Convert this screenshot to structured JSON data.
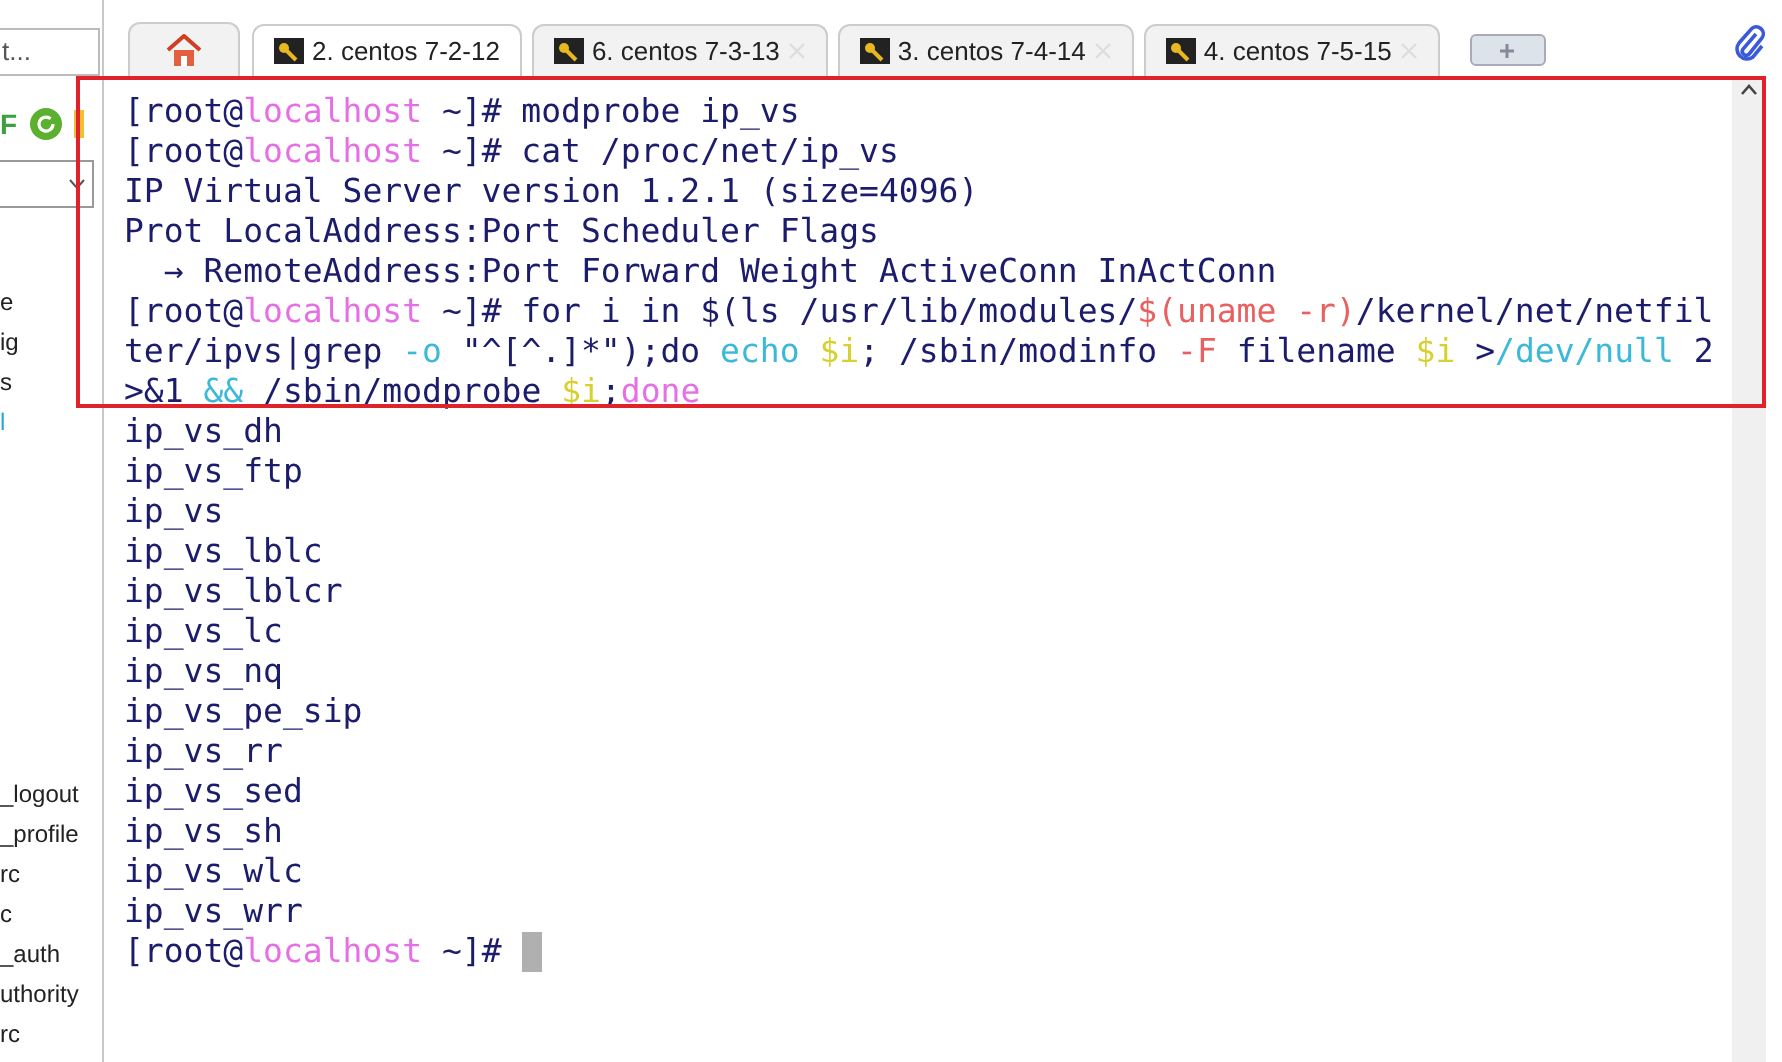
{
  "sidebar": {
    "search": {
      "value": "t..."
    },
    "letter": "F",
    "items_top": [
      {
        "label": "e",
        "selected": false
      },
      {
        "label": "ig",
        "selected": false
      },
      {
        "label": "s",
        "selected": false
      },
      {
        "label": "l",
        "selected": true
      }
    ],
    "items_bottom": [
      {
        "label": "_logout",
        "selected": false
      },
      {
        "label": "_profile",
        "selected": false
      },
      {
        "label": "rc",
        "selected": false
      },
      {
        "label": "c",
        "selected": false
      },
      {
        "label": "_auth",
        "selected": false
      },
      {
        "label": "uthority",
        "selected": false
      },
      {
        "label": "rc",
        "selected": false
      }
    ]
  },
  "tabs": [
    {
      "label": "2. centos 7-2-12",
      "selected": true
    },
    {
      "label": "6. centos 7-3-13",
      "selected": false
    },
    {
      "label": "3. centos 7-4-14",
      "selected": false
    },
    {
      "label": "4. centos 7-5-15",
      "selected": false
    }
  ],
  "terminal": {
    "cursor": true,
    "lines": [
      {
        "segments": [
          {
            "text": "[root@",
            "kind": "plain"
          },
          {
            "text": "localhost",
            "kind": "host"
          },
          {
            "text": " ~]# modprobe ip_vs",
            "kind": "plain"
          }
        ]
      },
      {
        "segments": [
          {
            "text": "[root@",
            "kind": "plain"
          },
          {
            "text": "localhost",
            "kind": "host"
          },
          {
            "text": " ~]# cat /proc/net/ip_vs",
            "kind": "plain"
          }
        ]
      },
      {
        "segments": [
          {
            "text": "IP Virtual Server version 1.2.1 (size=4096)",
            "kind": "plain"
          }
        ]
      },
      {
        "segments": [
          {
            "text": "Prot LocalAddress:Port Scheduler Flags",
            "kind": "plain"
          }
        ]
      },
      {
        "segments": [
          {
            "text": "  → RemoteAddress:Port Forward Weight ActiveConn InActConn",
            "kind": "plain"
          }
        ]
      },
      {
        "segments": [
          {
            "text": "[root@",
            "kind": "plain"
          },
          {
            "text": "localhost",
            "kind": "host"
          },
          {
            "text": " ~]# for i in $(ls /usr/lib/modules/",
            "kind": "plain"
          },
          {
            "text": "$(uname -r)",
            "kind": "subst"
          },
          {
            "text": "/kernel/net/netfil",
            "kind": "plain"
          }
        ]
      },
      {
        "segments": [
          {
            "text": "ter/ipvs|grep ",
            "kind": "plain"
          },
          {
            "text": "-o",
            "kind": "flag"
          },
          {
            "text": " \"^[^.]*\");do ",
            "kind": "plain"
          },
          {
            "text": "echo",
            "kind": "flag"
          },
          {
            "text": " $i",
            "kind": "var"
          },
          {
            "text": "; /sbin/modinfo ",
            "kind": "plain"
          },
          {
            "text": "-F",
            "kind": "subst"
          },
          {
            "text": " filename ",
            "kind": "plain"
          },
          {
            "text": "$i",
            "kind": "var"
          },
          {
            "text": " >",
            "kind": "plain"
          },
          {
            "text": "/dev/null",
            "kind": "flag"
          },
          {
            "text": " 2",
            "kind": "plain"
          }
        ]
      },
      {
        "segments": [
          {
            "text": ">&1 ",
            "kind": "plain"
          },
          {
            "text": "&&",
            "kind": "flag"
          },
          {
            "text": " /sbin/modprobe ",
            "kind": "plain"
          },
          {
            "text": "$i",
            "kind": "var"
          },
          {
            "text": ";",
            "kind": "plain"
          },
          {
            "text": "done",
            "kind": "host"
          }
        ]
      },
      {
        "segments": [
          {
            "text": "ip_vs_dh",
            "kind": "plain"
          }
        ]
      },
      {
        "segments": [
          {
            "text": "ip_vs_ftp",
            "kind": "plain"
          }
        ]
      },
      {
        "segments": [
          {
            "text": "ip_vs",
            "kind": "plain"
          }
        ]
      },
      {
        "segments": [
          {
            "text": "ip_vs_lblc",
            "kind": "plain"
          }
        ]
      },
      {
        "segments": [
          {
            "text": "ip_vs_lblcr",
            "kind": "plain"
          }
        ]
      },
      {
        "segments": [
          {
            "text": "ip_vs_lc",
            "kind": "plain"
          }
        ]
      },
      {
        "segments": [
          {
            "text": "ip_vs_nq",
            "kind": "plain"
          }
        ]
      },
      {
        "segments": [
          {
            "text": "ip_vs_pe_sip",
            "kind": "plain"
          }
        ]
      },
      {
        "segments": [
          {
            "text": "ip_vs_rr",
            "kind": "plain"
          }
        ]
      },
      {
        "segments": [
          {
            "text": "ip_vs_sed",
            "kind": "plain"
          }
        ]
      },
      {
        "segments": [
          {
            "text": "ip_vs_sh",
            "kind": "plain"
          }
        ]
      },
      {
        "segments": [
          {
            "text": "ip_vs_wlc",
            "kind": "plain"
          }
        ]
      },
      {
        "segments": [
          {
            "text": "ip_vs_wrr",
            "kind": "plain"
          }
        ]
      },
      {
        "segments": [
          {
            "text": "[root@",
            "kind": "plain"
          },
          {
            "text": "localhost",
            "kind": "host"
          },
          {
            "text": " ~]# ",
            "kind": "plain"
          }
        ]
      }
    ]
  }
}
